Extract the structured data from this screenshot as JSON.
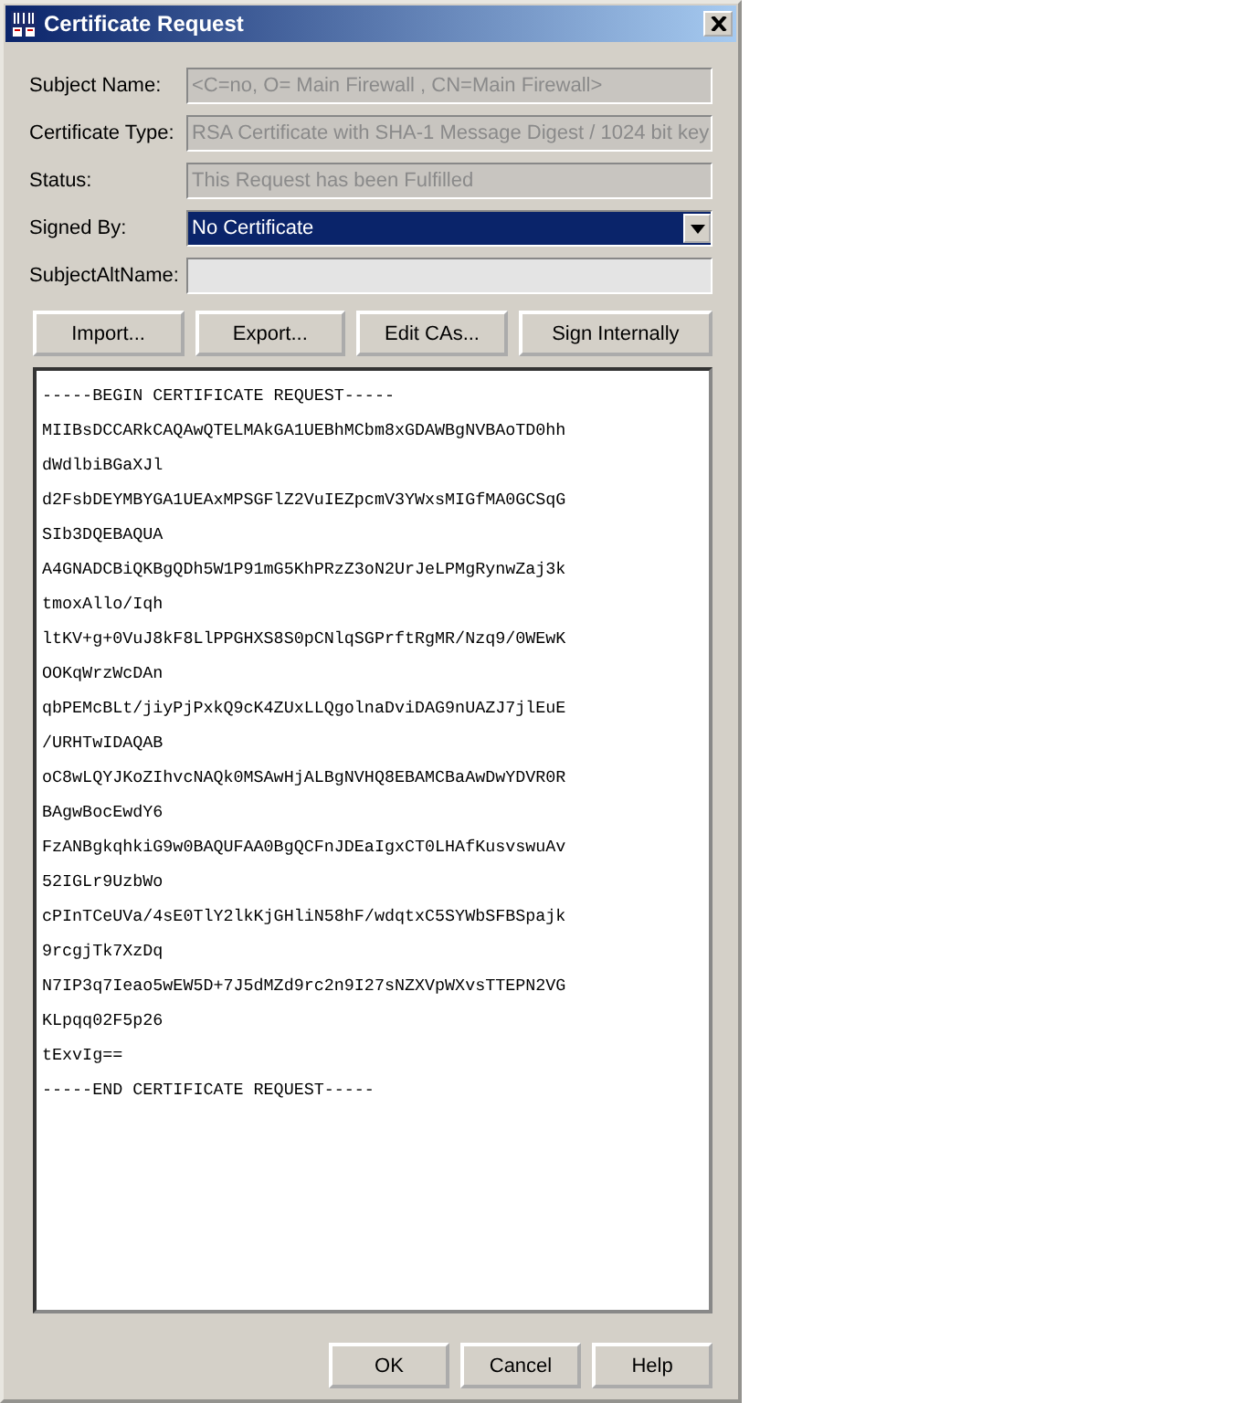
{
  "window": {
    "title": "Certificate Request"
  },
  "fields": [
    {
      "label": "Subject Name:",
      "kind": "text",
      "value": "<C=no, O= Main Firewall , CN=Main Firewall>",
      "disabled": true
    },
    {
      "label": "Certificate Type:",
      "kind": "text",
      "value": "RSA Certificate with SHA-1 Message Digest / 1024 bit key",
      "disabled": true
    },
    {
      "label": "Status:",
      "kind": "text",
      "value": "This Request has been Fulfilled",
      "disabled": true
    },
    {
      "label": "Signed By:",
      "kind": "dropdown",
      "value": "No Certificate",
      "disabled": false
    },
    {
      "label": "SubjectAltName:",
      "kind": "text",
      "disabled": false
    }
  ],
  "actions": [
    "Import...",
    "Export...",
    "Edit CAs...",
    "Sign Internally"
  ],
  "request_text": [
    "-----BEGIN CERTIFICATE REQUEST-----",
    "MIIBsDCCARkCAQAwQTELMAkGA1UEBhMCbm8xGDAWBgNVBAoTD0hh",
    "dWdlbiBGaXJl",
    "d2FsbDEYMBYGA1UEAxMPSGFlZ2VuIEZpcmV3YWxsMIGfMA0GCSqG",
    "SIb3DQEBAQUA",
    "A4GNADCBiQKBgQDh5W1P91mG5KhPRzZ3oN2UrJeLPMgRynwZaj3k",
    "tmoxAllo/Iqh",
    "ltKV+g+0VuJ8kF8LlPPGHXS8S0pCNlqSGPrftRgMR/Nzq9/0WEwK",
    "OOKqWrzWcDAn",
    "qbPEMcBLt/jiyPjPxkQ9cK4ZUxLLQgolnaDviDAG9nUAZJ7jlEuE",
    "/URHTwIDAQAB",
    "oC8wLQYJKoZIhvcNAQk0MSAwHjALBgNVHQ8EBAMCBaAwDwYDVR0R",
    "BAgwBocEwdY6",
    "FzANBgkqhkiG9w0BAQUFAA0BgQCFnJDEaIgxCT0LHAfKusvswuAv",
    "52IGLr9UzbWo",
    "cPInTCeUVa/4sE0TlY2lkKjGHliN58hF/wdqtxC5SYWbSFBSpajk",
    "9rcgjTk7XzDq",
    "N7IP3q7Ieao5wEW5D+7J5dMZd9rc2n9I27sNZXVpWXvsTTEPN2VG",
    "KLpqq02F5p26",
    "tExvIg==",
    "-----END CERTIFICATE REQUEST-----"
  ],
  "buttons": [
    "OK",
    "Cancel",
    "Help"
  ]
}
